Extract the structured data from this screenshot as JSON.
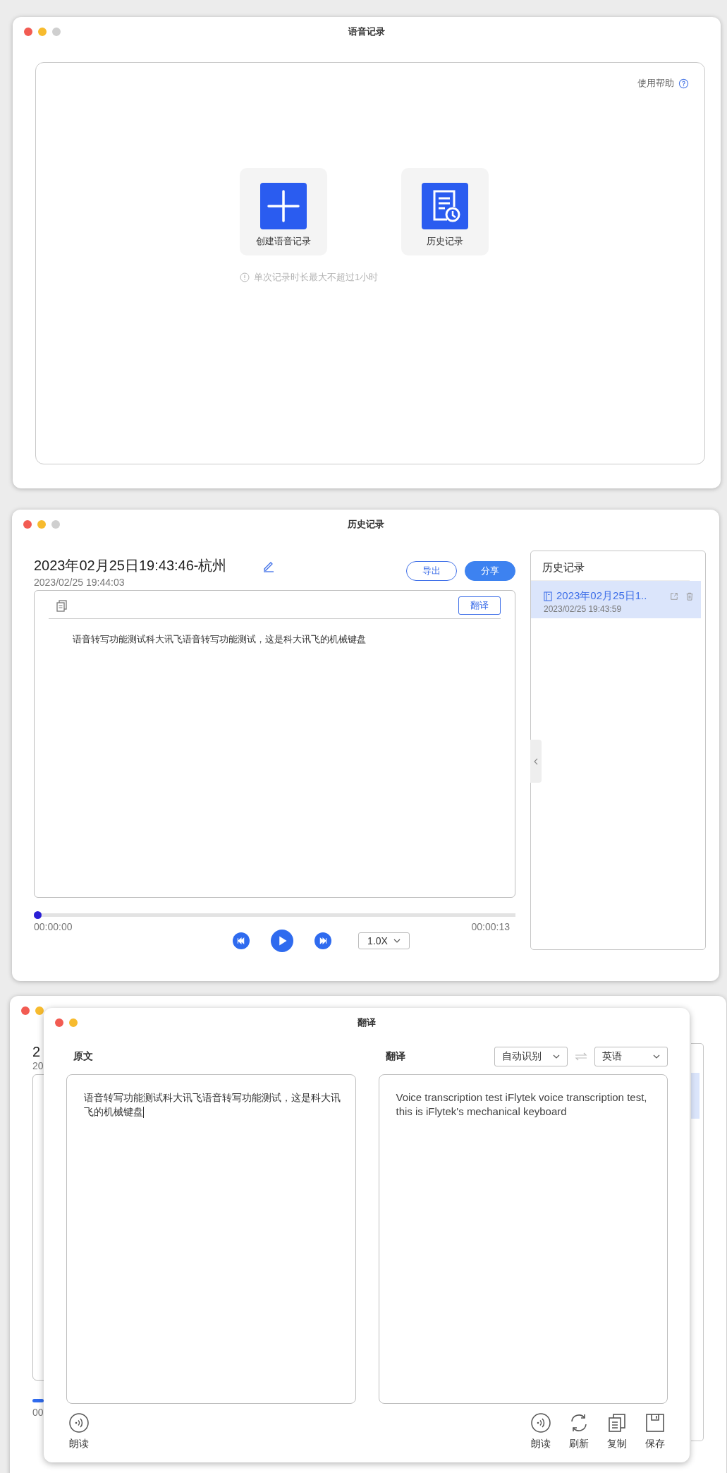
{
  "record_window": {
    "title": "语音记录",
    "help_link": "使用帮助",
    "actions": [
      {
        "label": "创建语音记录",
        "kind": "create"
      },
      {
        "label": "历史记录",
        "kind": "history"
      }
    ],
    "notice": "单次记录时长最大不超过1小时"
  },
  "history_window": {
    "title": "历史记录",
    "record_title": "2023年02月25日19:43:46-杭州",
    "record_time": "2023/02/25 19:44:03",
    "buttons": [
      {
        "label": "导出",
        "kind": "outline"
      },
      {
        "label": "分享",
        "kind": "filled"
      }
    ],
    "translate_button": "翻译",
    "transcript": "语音转写功能测试科大讯飞语音转写功能测试，这是科大讯飞的机械键盘",
    "playback": {
      "level": 0,
      "elapsed": "00:00:00",
      "total": "00:00:13",
      "speed": "1.0X"
    },
    "sidebar": {
      "title": "历史记录",
      "items": [
        {
          "title": "2023年02月25日1..",
          "time": "2023/02/25 19:43:59",
          "selected": true
        }
      ]
    }
  },
  "background_window": {
    "title_fragment": "2",
    "date_fragment": "20",
    "time_fragment": "00"
  },
  "translate_window": {
    "title": "翻译",
    "source_label": "原文",
    "target_label": "翻译",
    "source_language": "自动识别",
    "target_language": "英语",
    "source_text": "语音转写功能测试科大讯飞语音转写功能测试，这是科大讯飞的机械键盘",
    "translated_text": "Voice transcription test iFlytek voice transcription test, this is iFlytek's mechanical keyboard",
    "left_actions": [
      {
        "label": "朗读",
        "kind": "read"
      }
    ],
    "right_actions": [
      {
        "label": "朗读",
        "kind": "read"
      },
      {
        "label": "刷新",
        "kind": "refresh"
      },
      {
        "label": "复制",
        "kind": "copy"
      },
      {
        "label": "保存",
        "kind": "save"
      }
    ]
  }
}
